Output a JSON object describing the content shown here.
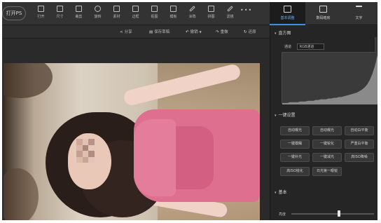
{
  "toolbar": {
    "open_label": "打开PS",
    "tools": [
      {
        "label": "打开",
        "icon": "open-icon"
      },
      {
        "label": "尺寸",
        "icon": "resize-icon"
      },
      {
        "label": "裁剪",
        "icon": "crop-icon"
      },
      {
        "label": "旋转",
        "icon": "rotate-icon"
      },
      {
        "label": "素材",
        "icon": "material-icon"
      },
      {
        "label": "边框",
        "icon": "border-icon"
      },
      {
        "label": "抠图",
        "icon": "cutout-icon"
      },
      {
        "label": "模板",
        "icon": "template-icon"
      },
      {
        "label": "涂鸦",
        "icon": "doodle-icon"
      },
      {
        "label": "拼图",
        "icon": "collage-icon"
      },
      {
        "label": "滤镜",
        "icon": "filter-icon"
      }
    ],
    "more": "•••"
  },
  "right_tabs": [
    {
      "label": "基本调整",
      "icon": "adjust-icon",
      "active": true
    },
    {
      "label": "数码暗房",
      "icon": "camera-icon",
      "active": false
    },
    {
      "label": "文字",
      "icon": "text-icon",
      "active": false
    }
  ],
  "subbar": {
    "share": "分享",
    "save_draft": "保存草稿",
    "undo": "撤销",
    "redo": "重做",
    "restore": "还原"
  },
  "panel": {
    "histogram_title": "直方图",
    "channel_label": "通道",
    "channel_value": "RGB通道",
    "oneclick_title": "一键设置",
    "buttons": [
      "自动曝光",
      "自动曝光",
      "自动白平衡",
      "一键模糊",
      "一键锐化",
      "严重白平衡",
      "一键补光",
      "一键减光",
      "高ISO降噪",
      "高ISO锐化",
      "日光第一眼锐"
    ],
    "basic_title": "基本",
    "slider_label": "亮度",
    "slider_level": 0.58
  },
  "colors": {
    "accent": "#3b8fe0",
    "dress": "#de6f8f",
    "panel_bg": "#252525"
  },
  "histogram": [
    2,
    2,
    2,
    3,
    3,
    3,
    3,
    4,
    4,
    4,
    5,
    5,
    5,
    6,
    6,
    7,
    7,
    7,
    8,
    8,
    9,
    9,
    10,
    10,
    11,
    12,
    13,
    14,
    15,
    16,
    18,
    20,
    23,
    27,
    33,
    41,
    52,
    66
  ]
}
